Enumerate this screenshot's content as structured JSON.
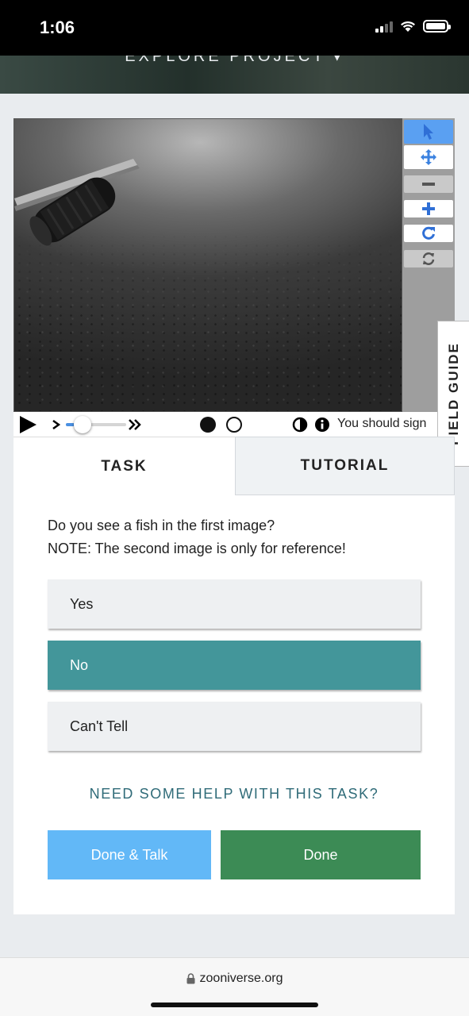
{
  "status_bar": {
    "time": "1:06",
    "icons": [
      "cellular-signal-icon",
      "wifi-icon",
      "battery-icon"
    ]
  },
  "project_header": {
    "label": "EXPLORE PROJECT ▾"
  },
  "viewer": {
    "image_description": "underwater camera frame with seafloor and equipment",
    "toolbar": [
      "pointer-icon",
      "pan-icon",
      "zoom-out-icon",
      "zoom-in-icon",
      "rotate-icon",
      "reset-icon"
    ]
  },
  "field_guide": {
    "label": "FIELD GUIDE"
  },
  "playback": {
    "play_icon": "play-icon",
    "step_icon": "chevron-right-icon",
    "speed_icon": "double-chevron-icon",
    "slider_progress": 0.14,
    "frames": [
      "frame-1-selected",
      "frame-2"
    ],
    "contrast_icon": "contrast-icon",
    "info_icon": "info-icon",
    "sign_message": "You should sign"
  },
  "task": {
    "tabs": [
      {
        "label": "TASK"
      },
      {
        "label": "TUTORIAL"
      }
    ],
    "question_line1": "Do you see a fish in the first image?",
    "question_line2": "NOTE: The second image is only for reference!",
    "answers": [
      {
        "label": "Yes",
        "selected": false
      },
      {
        "label": "No",
        "selected": true
      },
      {
        "label": "Can't Tell",
        "selected": false
      }
    ],
    "help_link": "NEED SOME HELP WITH THIS TASK?",
    "done_talk_label": "Done & Talk",
    "done_label": "Done"
  },
  "colors": {
    "selected_answer": "#43969a",
    "done": "#3c8b55",
    "done_talk": "#62b8f7",
    "help_link": "#2f6b78",
    "toolbar_active": "#5aa0f2"
  },
  "browser": {
    "url": "zooniverse.org",
    "lock_icon": "lock-icon"
  }
}
